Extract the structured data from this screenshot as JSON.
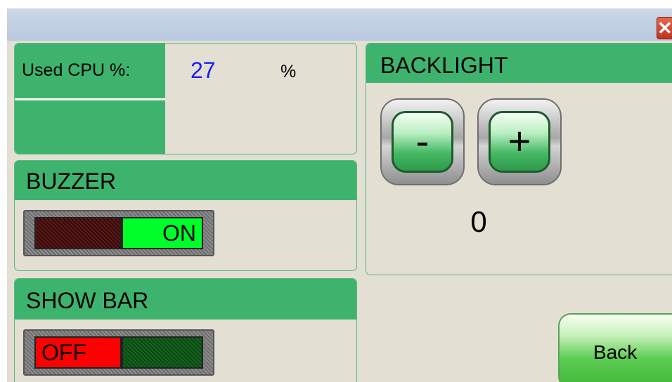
{
  "window": {
    "close_glyph": "✕"
  },
  "cpu": {
    "label": "Used CPU %:",
    "value": "27",
    "unit": "%"
  },
  "buzzer": {
    "title": "BUZZER",
    "state_label": "ON",
    "state": "on"
  },
  "show_bar": {
    "title": "SHOW BAR",
    "state_label": "OFF",
    "state": "off"
  },
  "backlight": {
    "title": "BACKLIGHT",
    "decrease_label": "-",
    "increase_label": "+",
    "value": "0"
  },
  "back_button": {
    "label": "Back"
  },
  "colors": {
    "panel_green": "#3eb36e",
    "background": "#e3dfd3",
    "cpu_value_blue": "#1a1aff",
    "on_green": "#00ff2a",
    "off_red": "#ff0000"
  }
}
